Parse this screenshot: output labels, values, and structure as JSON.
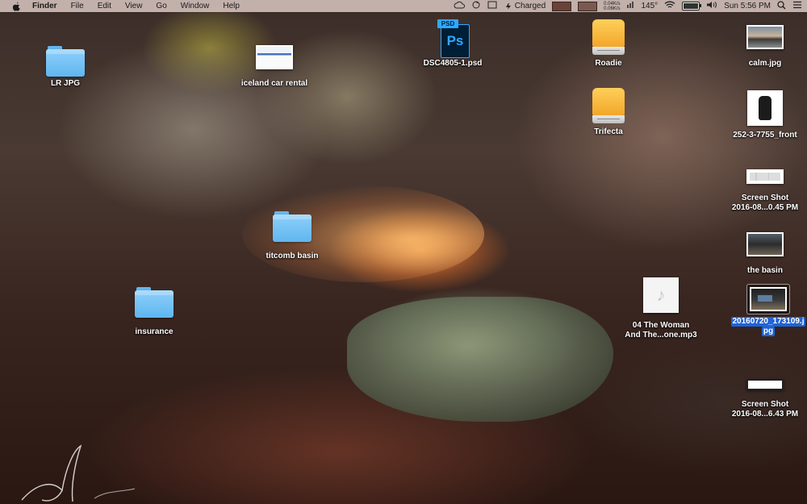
{
  "menubar": {
    "app": "Finder",
    "items": [
      "File",
      "Edit",
      "View",
      "Go",
      "Window",
      "Help"
    ],
    "status": {
      "battery_text": "Charged",
      "net_up": "0.04K/s",
      "net_down": "0.06K/s",
      "temperature": "145°",
      "clock": "Sun 5:56 PM"
    }
  },
  "desktop": {
    "lr_jpg": "LR JPG",
    "iceland": "iceland car rental",
    "psd_file": "DSC4805-1.psd",
    "psd_badge": "PSD",
    "psd_glyph": "Ps",
    "roadie": "Roadie",
    "trifecta": "Trifecta",
    "calm": "calm.jpg",
    "front": "252-3-7755_front",
    "screenshot1_line1": "Screen Shot",
    "screenshot1_line2": "2016-08...0.45 PM",
    "titcomb": "titcomb basin",
    "the_basin": "the basin",
    "insurance": "insurance",
    "mp3_line1": "04 The Woman",
    "mp3_line2": "And The...one.mp3",
    "selected_line1": "20160720_173109.j",
    "selected_line2": "pg",
    "screenshot2_line1": "Screen Shot",
    "screenshot2_line2": "2016-08...6.43 PM"
  },
  "colors": {
    "selection": "#1f63d6",
    "folder": "#7cc6f7",
    "drive": "#f5b53a"
  }
}
